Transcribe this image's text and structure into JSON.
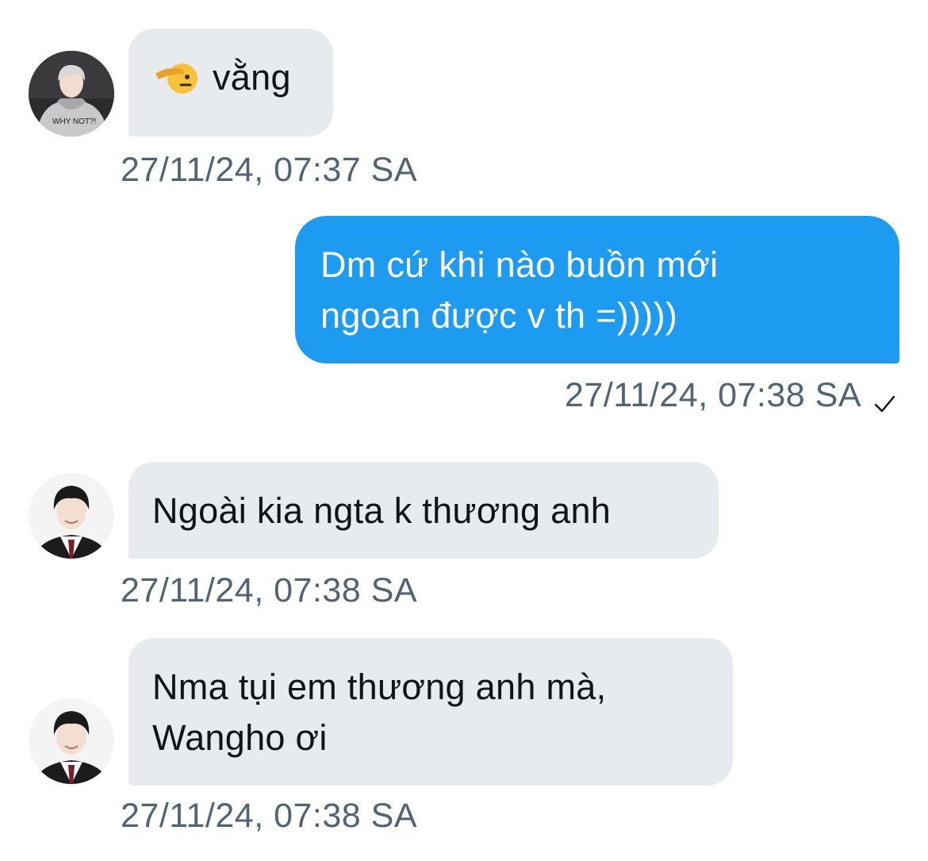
{
  "messages": [
    {
      "direction": "incoming",
      "emoji_icon": "saluting-face-icon",
      "text": "vằng",
      "timestamp": "27/11/24, 07:37 SA"
    },
    {
      "direction": "outgoing",
      "lines": [
        "Dm cứ khi nào buồn mới",
        "ngoan được v th =)))))"
      ],
      "timestamp": "27/11/24, 07:38 SA",
      "status_icon": "checkmark-icon"
    },
    {
      "direction": "incoming",
      "text": "Ngoài kia ngta k thương anh",
      "timestamp": "27/11/24, 07:38 SA"
    },
    {
      "direction": "incoming",
      "lines": [
        "Nma tụi em thương anh mà,",
        "Wangho ơi"
      ],
      "timestamp": "27/11/24, 07:38 SA"
    }
  ],
  "colors": {
    "incoming_bubble": "#e8ebee",
    "outgoing_bubble": "#1d9bf0",
    "timestamp": "#536471",
    "text": "#0f1419"
  }
}
